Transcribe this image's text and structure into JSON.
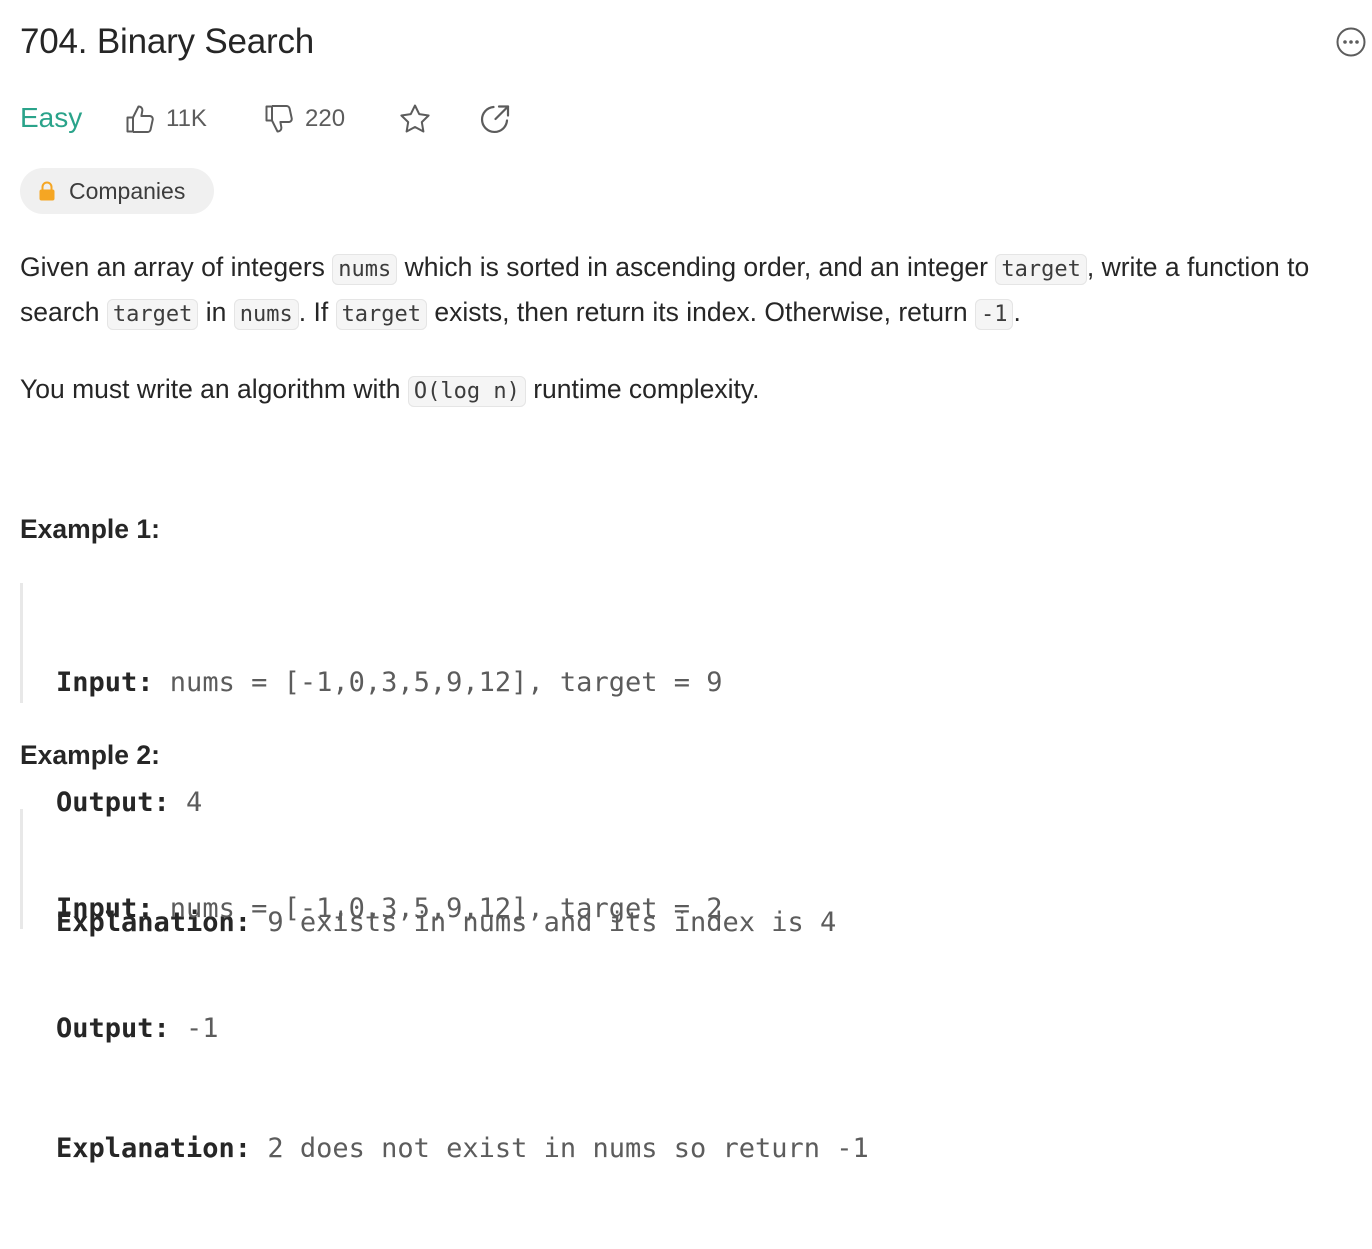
{
  "problem": {
    "title": "704. Binary Search",
    "difficulty": "Easy",
    "likes": "11K",
    "dislikes": "220",
    "companies_label": "Companies"
  },
  "description": {
    "p1": {
      "t1": "Given an array of integers ",
      "c1": "nums",
      "t2": " which is sorted in ascending order, and an integer ",
      "c2": "target",
      "t3": ", write a function to search ",
      "c3": "target",
      "t4": " in ",
      "c4": "nums",
      "t5": ". If ",
      "c5": "target",
      "t6": " exists, then return its index. Otherwise, return ",
      "c6": "-1",
      "t7": "."
    },
    "p2": {
      "t1": "You must write an algorithm with ",
      "c1": "O(log n)",
      "t2": " runtime complexity."
    }
  },
  "examples": [
    {
      "heading": "Example 1:",
      "input_key": "Input:",
      "input_val": " nums = [-1,0,3,5,9,12], target = 9",
      "output_key": "Output:",
      "output_val": " 4",
      "explanation_key": "Explanation:",
      "explanation_val": " 9 exists in nums and its index is 4"
    },
    {
      "heading": "Example 2:",
      "input_key": "Input:",
      "input_val": " nums = [-1,0,3,5,9,12], target = 2",
      "output_key": "Output:",
      "output_val": " -1",
      "explanation_key": "Explanation:",
      "explanation_val": " 2 does not exist in nums so return -1"
    }
  ],
  "icons": {
    "more": "more-options-icon",
    "like": "thumbs-up-icon",
    "dislike": "thumbs-down-icon",
    "favorite": "star-icon",
    "share": "share-icon",
    "lock": "lock-icon"
  },
  "colors": {
    "easy": "#2aa38a",
    "lock": "#f5a623",
    "text": "#262626",
    "muted": "#5c5c5c"
  }
}
